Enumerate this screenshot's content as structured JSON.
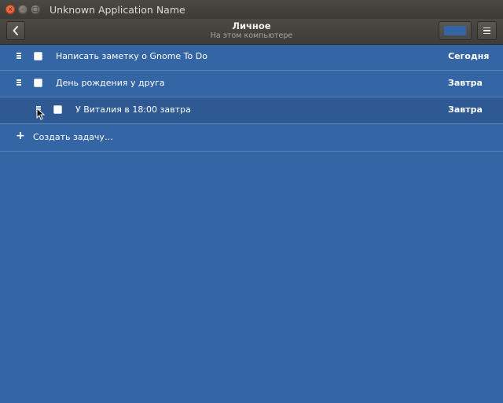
{
  "window": {
    "title": "Unknown Application Name",
    "buttons": {
      "close_glyph": "×",
      "minimize_glyph": "–",
      "maximize_glyph": "□"
    }
  },
  "header": {
    "title": "Личное",
    "subtitle": "На этом компьютере",
    "back_icon": "chevron-left-icon",
    "menu_icon": "hamburger-icon",
    "list_color": "#3465a4"
  },
  "tasks": [
    {
      "title": "Написать заметку о Gnome To Do",
      "due": "Сегодня",
      "completed": false,
      "subtask": false
    },
    {
      "title": "День рождения у друга",
      "due": "Завтра",
      "completed": false,
      "subtask": false
    },
    {
      "title": "У Виталия в 18:00 завтра",
      "due": "Завтра",
      "completed": false,
      "subtask": true,
      "selected": true
    }
  ],
  "add_task": {
    "icon": "plus-icon",
    "plus_glyph": "+",
    "label": "Создать задачу…"
  },
  "colors": {
    "list_background": "#3465a4",
    "selected_row": "#2e5992",
    "header": "#3e3d39"
  }
}
